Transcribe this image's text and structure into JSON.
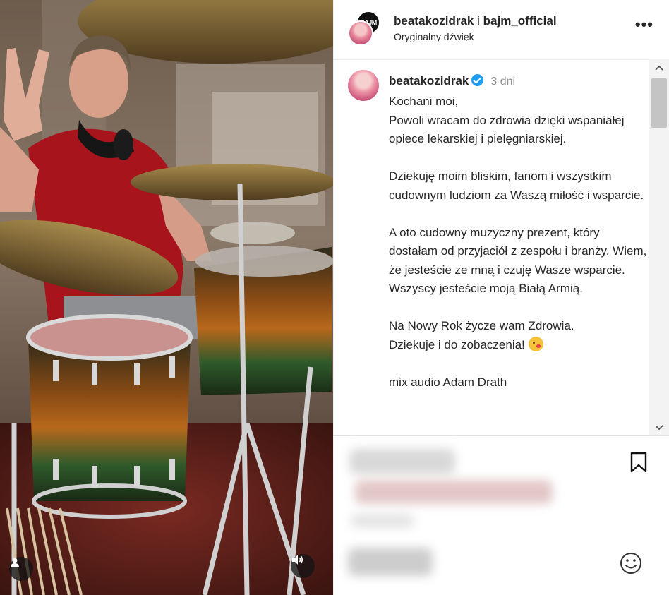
{
  "header": {
    "author_avatar_text": "BAJM",
    "author_primary": "beatakozidrak",
    "author_joiner": "i",
    "author_secondary": "bajm_official",
    "audio_label": "Oryginalny dźwięk",
    "more_label": "•••"
  },
  "caption": {
    "username": "beatakozidrak",
    "verified": true,
    "time": "3 dni",
    "lines": [
      "Kochani moi,\nPowoli wracam do zdrowia dzięki wspaniałej opiece lekarskiej i pielęgniarskiej.",
      "Dziekuję moim bliskim, fanom i wszystkim cudownym ludziom za Waszą miłość i wsparcie.",
      "A oto cudowny muzyczny prezent, który dostałam od przyjaciół z zespołu i branży. Wiem, że jesteście ze mną i czuję Wasze wsparcie.\nWszyscy jesteście moją Białą Armią.",
      "Na Nowy Rok życze wam Zdrowia.\nDziekuje i do zobaczenia!",
      "mix audio Adam Drath"
    ]
  },
  "colors": {
    "verified_badge": "#1d9bf0",
    "text": "#262626",
    "secondary_text": "#8e8e8e",
    "shirt": "#a8141c"
  },
  "icons": {
    "tag": "person-tag-icon",
    "sound": "speaker-icon",
    "bookmark": "bookmark-icon",
    "emoji": "smiley-icon",
    "more": "more-dots-icon"
  }
}
